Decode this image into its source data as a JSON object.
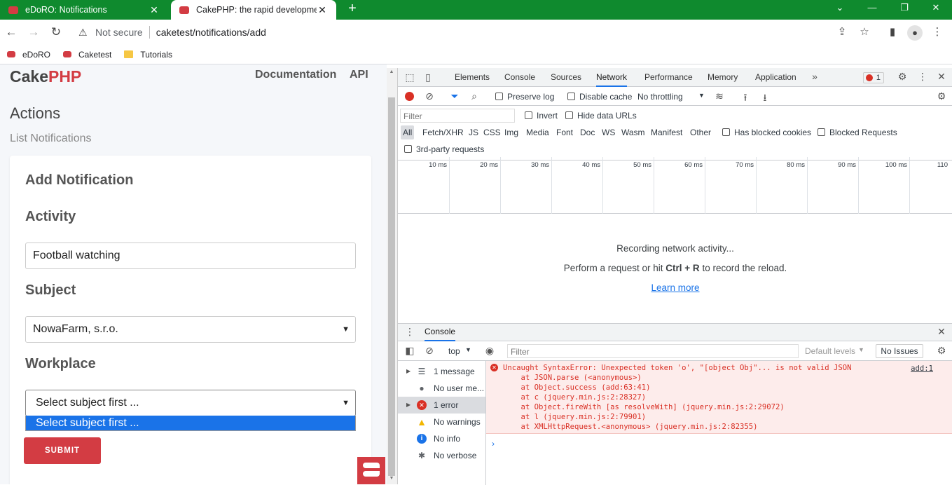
{
  "browser": {
    "tabs": [
      {
        "title": "eDoRO: Notifications",
        "active": false
      },
      {
        "title": "CakePHP: the rapid development",
        "active": true
      }
    ],
    "security_label": "Not secure",
    "url": "caketest/notifications/add",
    "bookmarks": [
      "eDoRO",
      "Caketest",
      "Tutorials"
    ]
  },
  "page": {
    "brand_left": "Cake",
    "brand_right": "PHP",
    "nav": [
      "Documentation",
      "API"
    ],
    "actions_heading": "Actions",
    "list_link": "List Notifications",
    "form": {
      "title": "Add Notification",
      "activity_label": "Activity",
      "activity_value": "Football watching",
      "subject_label": "Subject",
      "subject_value": "NowaFarm, s.r.o.",
      "workplace_label": "Workplace",
      "workplace_value": "Select subject first ...",
      "workplace_option": "Select subject first ...",
      "submit_label": "SUBMIT"
    }
  },
  "devtools": {
    "tabs": [
      "Elements",
      "Console",
      "Sources",
      "Network",
      "Performance",
      "Memory",
      "Application"
    ],
    "active_tab": "Network",
    "error_count": "1",
    "network": {
      "preserve_log": "Preserve log",
      "disable_cache": "Disable cache",
      "throttling": "No throttling",
      "filter_placeholder": "Filter",
      "invert": "Invert",
      "hide_data_urls": "Hide data URLs",
      "type_filters": [
        "All",
        "Fetch/XHR",
        "JS",
        "CSS",
        "Img",
        "Media",
        "Font",
        "Doc",
        "WS",
        "Wasm",
        "Manifest",
        "Other"
      ],
      "has_blocked_cookies": "Has blocked cookies",
      "blocked_requests": "Blocked Requests",
      "third_party": "3rd-party requests",
      "ticks": [
        "10 ms",
        "20 ms",
        "30 ms",
        "40 ms",
        "50 ms",
        "60 ms",
        "70 ms",
        "80 ms",
        "90 ms",
        "100 ms",
        "110"
      ],
      "recording": "Recording network activity...",
      "perform_pre": "Perform a request or hit ",
      "perform_keys": "Ctrl + R",
      "perform_post": " to record the reload.",
      "learn_more": "Learn more"
    },
    "console": {
      "drawer_tab": "Console",
      "context": "top",
      "filter_placeholder": "Filter",
      "levels": "Default levels",
      "issues": "No Issues",
      "sidebar": [
        {
          "label": "1 message"
        },
        {
          "label": "No user me..."
        },
        {
          "label": "1 error"
        },
        {
          "label": "No warnings"
        },
        {
          "label": "No info"
        },
        {
          "label": "No verbose"
        }
      ],
      "error_lines": [
        "Uncaught SyntaxError: Unexpected token 'o', \"[object Obj\"... is not valid JSON",
        "    at JSON.parse (<anonymous>)",
        "    at Object.success (add:63:41)",
        "    at c (jquery.min.js:2:28327)",
        "    at Object.fireWith [as resolveWith] (jquery.min.js:2:29072)",
        "    at l (jquery.min.js:2:79901)",
        "    at XMLHttpRequest.<anonymous> (jquery.min.js:2:82355)"
      ],
      "source_ref": "add:1"
    }
  }
}
